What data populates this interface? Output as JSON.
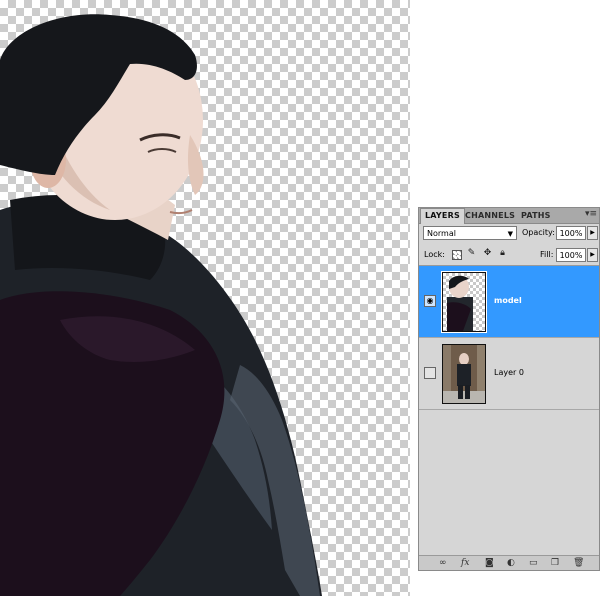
{
  "panel": {
    "tabs": [
      {
        "label": "LAYERS"
      },
      {
        "label": "CHANNELS"
      },
      {
        "label": "PATHS"
      }
    ],
    "menu_icon": "panel-menu-icon",
    "blend_mode": "Normal",
    "opacity_label": "Opacity:",
    "opacity_value": "100%",
    "lock_label": "Lock:",
    "fill_label": "Fill:",
    "fill_value": "100%",
    "layers": [
      {
        "name": "model",
        "selected": true,
        "visible": true
      },
      {
        "name": "Layer 0",
        "selected": false,
        "visible": false
      }
    ],
    "selection_color": "#3399ff",
    "footer_icons": [
      "link-layers-icon",
      "fx-icon",
      "layer-mask-icon",
      "adjustment-layer-icon",
      "group-folder-icon",
      "new-layer-icon",
      "trash-icon"
    ]
  }
}
